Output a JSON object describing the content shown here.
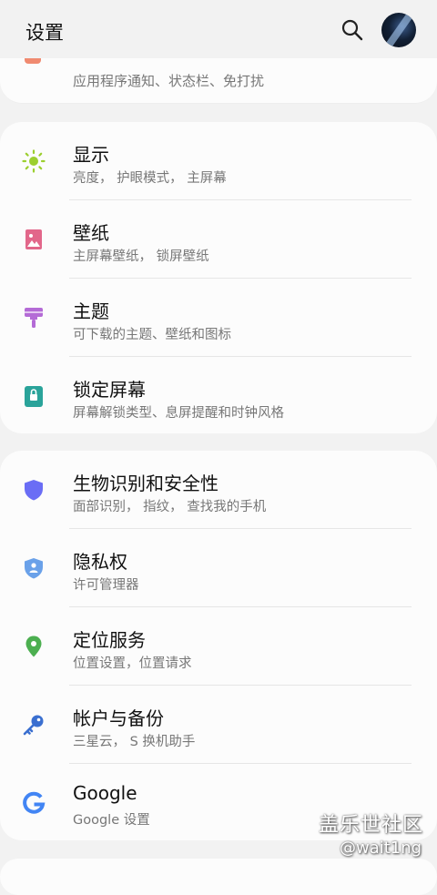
{
  "header": {
    "title": "设置"
  },
  "partial_card": {
    "subtitle": "应用程序通知、状态栏、免打扰"
  },
  "group1": [
    {
      "label": "显示",
      "subtitle": "亮度， 护眼模式， 主屏幕",
      "icon": "brightness-icon",
      "color": "#9ccf2f"
    },
    {
      "label": "壁纸",
      "subtitle": "主屏幕壁纸， 锁屏壁纸",
      "icon": "wallpaper-icon",
      "color": "#e2678a"
    },
    {
      "label": "主题",
      "subtitle": "可下载的主题、壁纸和图标",
      "icon": "theme-brush-icon",
      "color": "#b46bd6"
    },
    {
      "label": "锁定屏幕",
      "subtitle": "屏幕解锁类型、息屏提醒和时钟风格",
      "icon": "lock-icon",
      "color": "#2aa39a"
    }
  ],
  "group2": [
    {
      "label": "生物识别和安全性",
      "subtitle": "面部识别， 指纹， 查找我的手机",
      "icon": "shield-icon",
      "color": "#6a6df5"
    },
    {
      "label": "隐私权",
      "subtitle": "许可管理器",
      "icon": "privacy-shield-icon",
      "color": "#6aa1e9"
    },
    {
      "label": "定位服务",
      "subtitle": "位置设置，位置请求",
      "icon": "location-pin-icon",
      "color": "#4caf50"
    },
    {
      "label": "帐户与备份",
      "subtitle": "三星云， S 换机助手",
      "icon": "key-icon",
      "color": "#3a6fd0"
    },
    {
      "label": "Google",
      "subtitle": "Google 设置",
      "icon": "google-icon",
      "color": "#4285f4"
    }
  ],
  "watermark": {
    "line1": "盖乐世社区",
    "line2": "@wait1ng"
  }
}
